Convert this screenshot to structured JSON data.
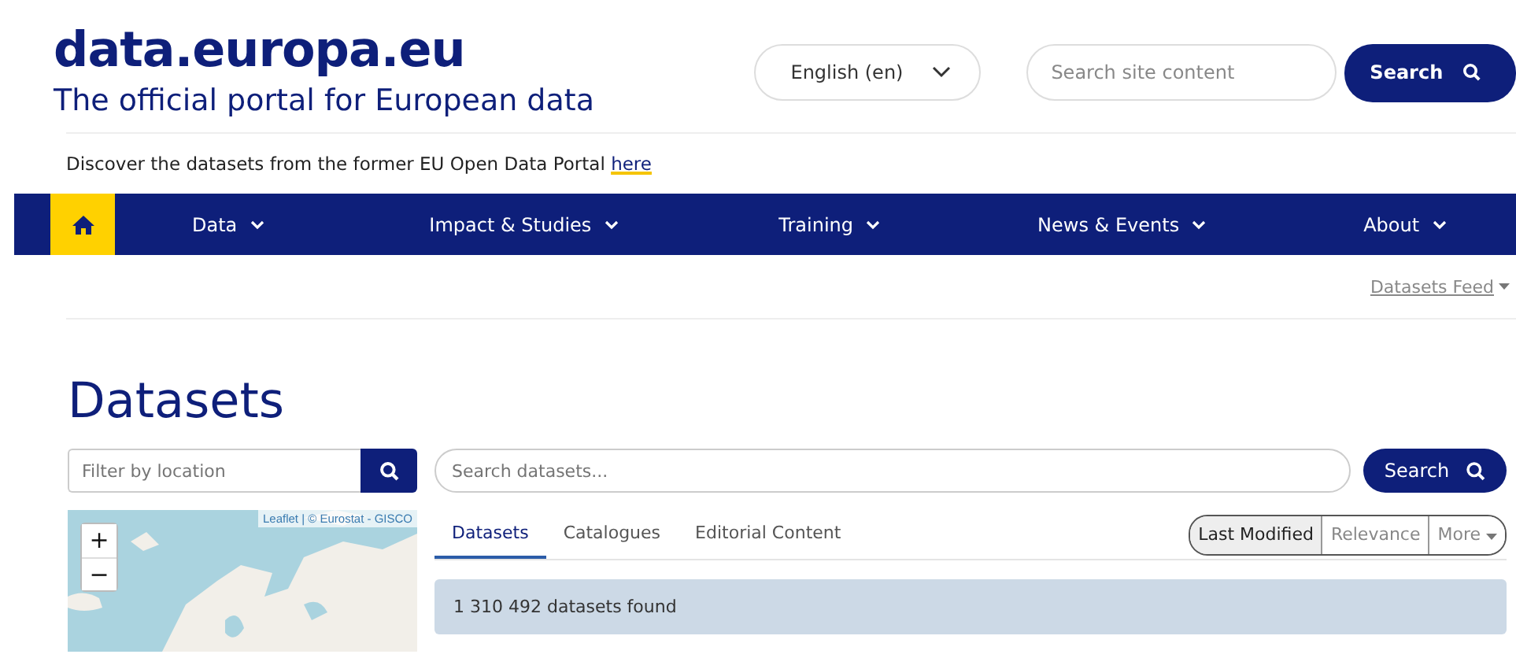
{
  "header": {
    "logo": "data.europa.eu",
    "tagline": "The official portal for European data",
    "language": "English (en)",
    "site_search": {
      "placeholder": "Search site content"
    },
    "search_button": "Search"
  },
  "notice": {
    "text": "Discover the datasets from the former EU Open Data Portal ",
    "link": "here"
  },
  "nav": {
    "items": [
      {
        "label": "Data"
      },
      {
        "label": "Impact & Studies"
      },
      {
        "label": "Training"
      },
      {
        "label": "News & Events"
      },
      {
        "label": "About"
      }
    ]
  },
  "feed_link": "Datasets Feed",
  "page_title": "Datasets",
  "location_filter": {
    "placeholder": "Filter by location"
  },
  "map": {
    "attribution": "Leaflet | © Eurostat - GISCO",
    "zoom_in": "+",
    "zoom_out": "−"
  },
  "dataset_search": {
    "placeholder": "Search datasets...",
    "button": "Search"
  },
  "tabs": [
    {
      "label": "Datasets",
      "selected": true
    },
    {
      "label": "Catalogues",
      "selected": false
    },
    {
      "label": "Editorial Content",
      "selected": false
    }
  ],
  "sort": [
    {
      "label": "Last Modified",
      "selected": true,
      "kind": "option"
    },
    {
      "label": "Relevance",
      "selected": false,
      "kind": "option"
    },
    {
      "label": "More",
      "selected": false,
      "kind": "dropdown"
    }
  ],
  "results": "1 310 492 datasets found"
}
